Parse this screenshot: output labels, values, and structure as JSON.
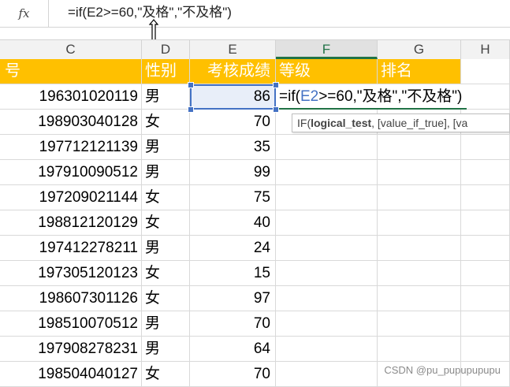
{
  "formula_bar": {
    "fx_label": "fx",
    "formula": "=if(E2>=60,\"及格\",\"不及格\")"
  },
  "columns": [
    "C",
    "D",
    "E",
    "F",
    "G",
    "H"
  ],
  "active_column": "F",
  "headers": {
    "id": "号",
    "sex": "性别",
    "score": "考核成绩",
    "grade": "等级",
    "rank": "排名"
  },
  "editing": {
    "prefix": "=if(",
    "ref": "E2",
    "suffix": ">=60,\"及格\",\"不及格\")"
  },
  "tooltip": {
    "fn": "IF(",
    "arg1": "logical_test",
    "rest": ", [value_if_true], [va"
  },
  "rows": [
    {
      "id": "196301020119",
      "sex": "男",
      "score": "86"
    },
    {
      "id": "198903040128",
      "sex": "女",
      "score": "70"
    },
    {
      "id": "197712121139",
      "sex": "男",
      "score": "35"
    },
    {
      "id": "197910090512",
      "sex": "男",
      "score": "99"
    },
    {
      "id": "197209021144",
      "sex": "女",
      "score": "75"
    },
    {
      "id": "198812120129",
      "sex": "女",
      "score": "40"
    },
    {
      "id": "197412278211",
      "sex": "男",
      "score": "24"
    },
    {
      "id": "197305120123",
      "sex": "女",
      "score": "15"
    },
    {
      "id": "198607301126",
      "sex": "女",
      "score": "97"
    },
    {
      "id": "198510070512",
      "sex": "男",
      "score": "70"
    },
    {
      "id": "197908278231",
      "sex": "男",
      "score": "64"
    },
    {
      "id": "198504040127",
      "sex": "女",
      "score": "70"
    }
  ],
  "watermark": "CSDN @pu_pupupupupu",
  "colors": {
    "header_fill": "#ffc000",
    "selection": "#4472c4",
    "accent_green": "#217346"
  }
}
